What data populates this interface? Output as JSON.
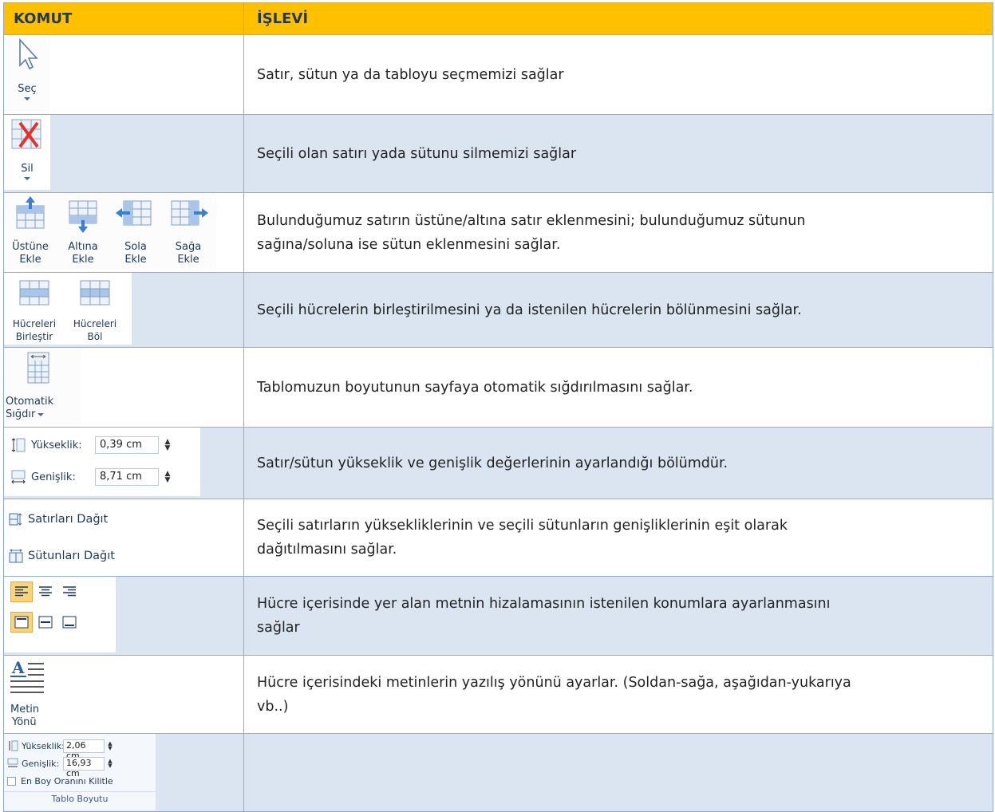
{
  "header": {
    "komut": "KOMUT",
    "islevi": "İŞLEVİ"
  },
  "rows": [
    {
      "desc_lines": [
        "Satır, sütun ya da tabloyu seçmemizi sağlar"
      ],
      "command": {
        "label": "Seç",
        "icon": "select-arrow-icon"
      }
    },
    {
      "desc_lines": [
        "Seçili olan satırı yada sütunu silmemizi sağlar"
      ],
      "command": {
        "label": "Sil",
        "icon": "delete-table-icon"
      }
    },
    {
      "desc_lines": [
        "Bulunduğumuz satırın üstüne/altına satır eklenmesini; bulunduğumuz sütunun",
        "sağına/soluna ise sütun eklenmesini sağlar."
      ],
      "command": {
        "buttons": [
          {
            "l1": "Üstüne",
            "l2": "Ekle",
            "icon": "insert-above-icon"
          },
          {
            "l1": "Altına",
            "l2": "Ekle",
            "icon": "insert-below-icon"
          },
          {
            "l1": "Sola",
            "l2": "Ekle",
            "icon": "insert-left-icon"
          },
          {
            "l1": "Sağa",
            "l2": "Ekle",
            "icon": "insert-right-icon"
          }
        ]
      }
    },
    {
      "desc_lines": [
        "Seçili hücrelerin birleştirilmesini ya da istenilen hücrelerin bölünmesini sağlar."
      ],
      "command": {
        "buttons": [
          {
            "l1": "Hücreleri",
            "l2": "Birleştir",
            "icon": "merge-cells-icon"
          },
          {
            "l1": "Hücreleri",
            "l2": "Böl",
            "icon": "split-cells-icon"
          }
        ]
      }
    },
    {
      "desc_lines": [
        "Tablomuzun boyutunun sayfaya otomatik sığdırılmasını sağlar."
      ],
      "command": {
        "l1": "Otomatik",
        "l2": "Sığdır",
        "icon": "autofit-icon"
      }
    },
    {
      "desc_lines": [
        "Satır/sütun yükseklik ve genişlik değerlerinin ayarlandığı bölümdür."
      ],
      "command": {
        "height_label": "Yükseklik:",
        "height_value": "0,39 cm",
        "width_label": "Genişlik:",
        "width_value": "8,71 cm"
      }
    },
    {
      "desc_lines": [
        "Seçili satırların yüksekliklerinin ve seçili sütunların genişliklerinin  eşit olarak",
        "dağıtılmasını sağlar."
      ],
      "command": {
        "rows_label": "Satırları Dağıt",
        "cols_label": "Sütunları Dağıt"
      }
    },
    {
      "desc_lines": [
        "Hücre içerisinde yer alan metnin hizalamasının istenilen konumlara ayarlanmasını",
        "sağlar"
      ],
      "command": {
        "icon": "alignment-icons"
      }
    },
    {
      "desc_lines": [
        "Hücre içerisindeki metinlerin yazılış yönünü ayarlar. (Soldan-sağa, aşağıdan-yukarıya",
        "vb..)"
      ],
      "command": {
        "l1": "Metin",
        "l2": "Yönü",
        "icon": "text-direction-icon"
      }
    },
    {
      "desc_lines": [],
      "command": {
        "height_label": "Yükseklik:",
        "height_value": "2,06 cm",
        "width_label": "Genişlik:",
        "width_value": "16,93 cm",
        "lock_label": "En Boy Oranını Kilitle",
        "group_label": "Tablo Boyutu"
      }
    }
  ],
  "colors": {
    "header_bg": "#ffc000",
    "header_text": "#1f3864",
    "band": "#dbe5f1",
    "border": "#8eaadb"
  }
}
